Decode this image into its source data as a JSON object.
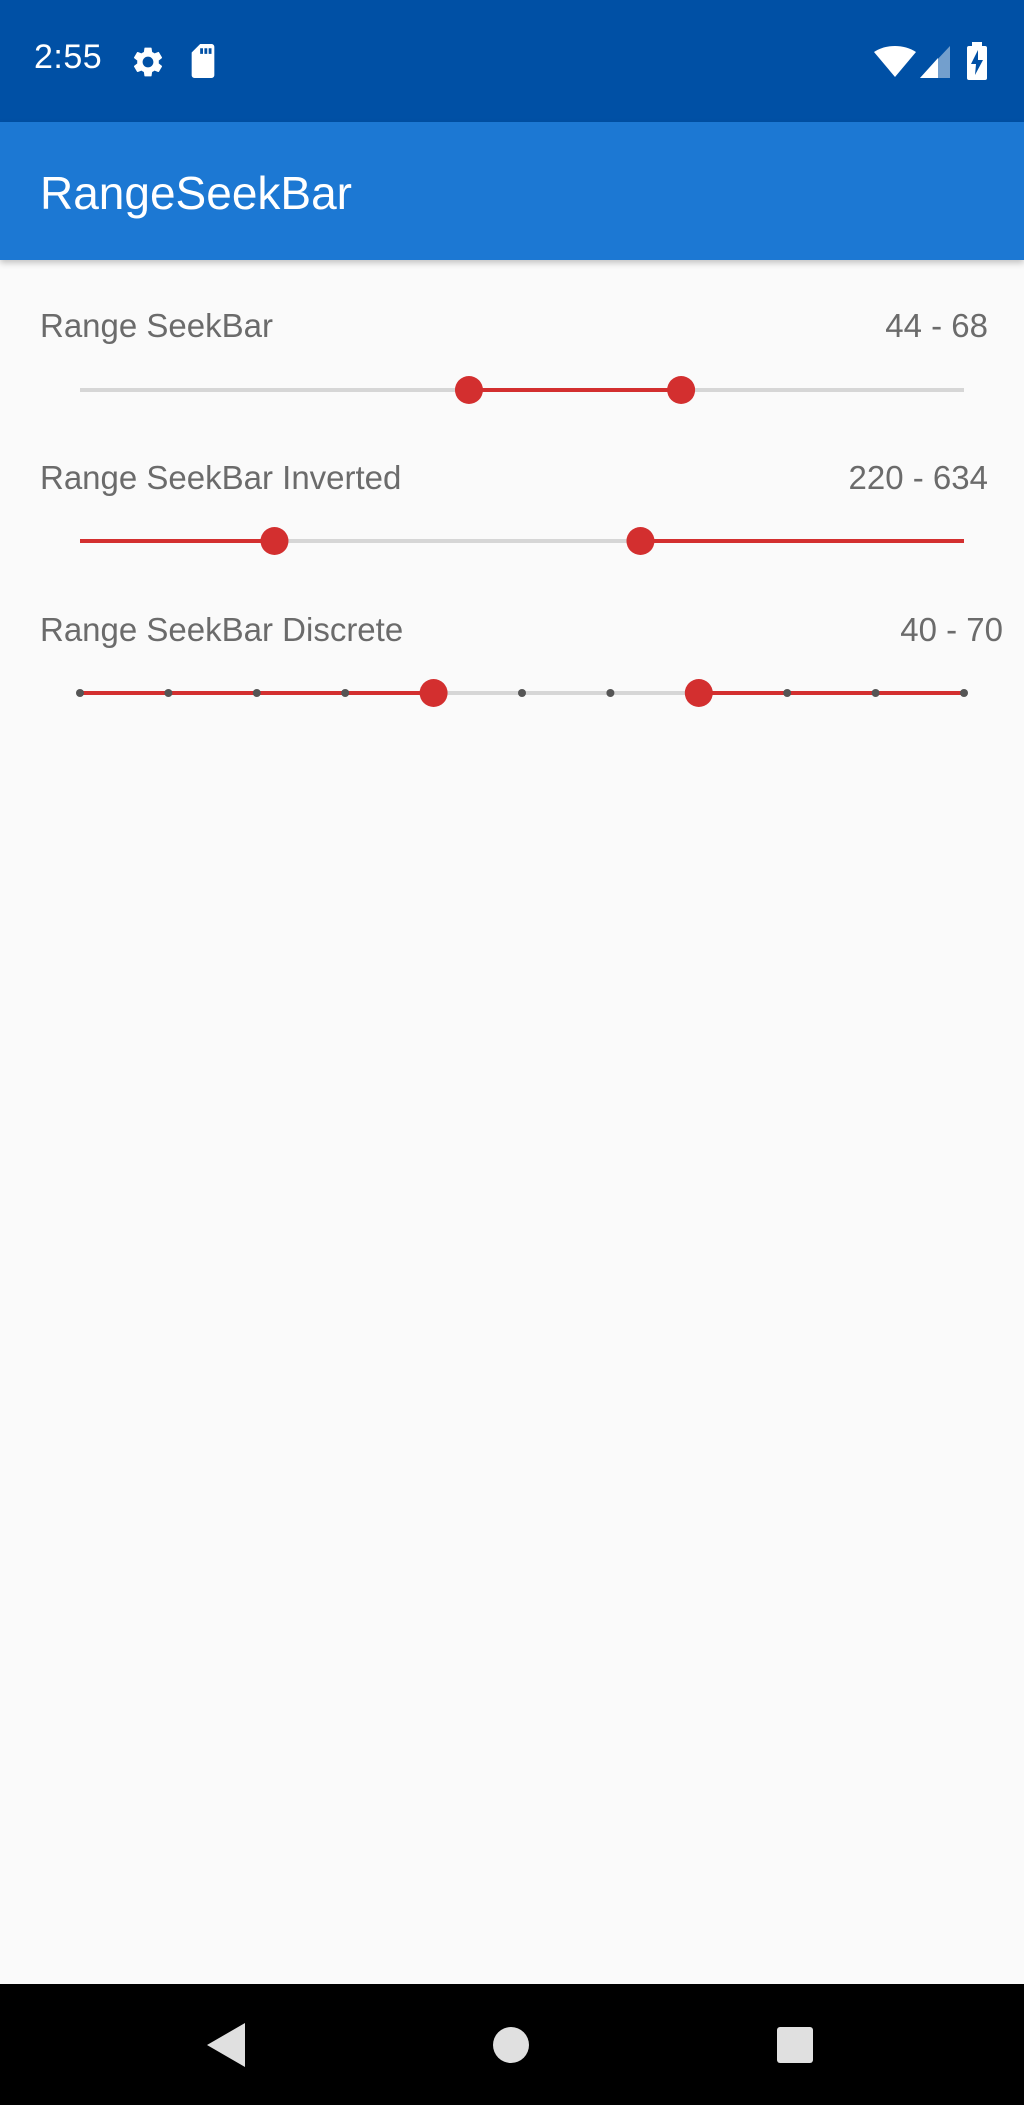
{
  "status_bar": {
    "time": "2:55",
    "icons": [
      "gear-icon",
      "sd-card-icon",
      "wifi-icon",
      "signal-icon",
      "battery-charging-icon"
    ],
    "background": "#0050a5"
  },
  "app_bar": {
    "title": "RangeSeekBar",
    "background": "#1c78d3"
  },
  "accent_color": "#d32f2f",
  "track_color": "#d6d6d6",
  "seekbars": [
    {
      "label": "Range SeekBar",
      "value_text": "44 - 68",
      "min": 0,
      "max": 100,
      "low": 44,
      "high": 68,
      "inverted": false,
      "discrete": false
    },
    {
      "label": "Range SeekBar Inverted",
      "value_text": "220 - 634",
      "min": 0,
      "max": 1000,
      "low": 220,
      "high": 634,
      "inverted": true,
      "discrete": false
    },
    {
      "label": "Range SeekBar Discrete",
      "value_text": "40 - 70",
      "min": 0,
      "max": 100,
      "low": 40,
      "high": 70,
      "inverted": true,
      "discrete": true,
      "step": 10
    }
  ],
  "nav_bar": {
    "buttons": [
      "back-icon",
      "home-icon",
      "recents-icon"
    ]
  }
}
